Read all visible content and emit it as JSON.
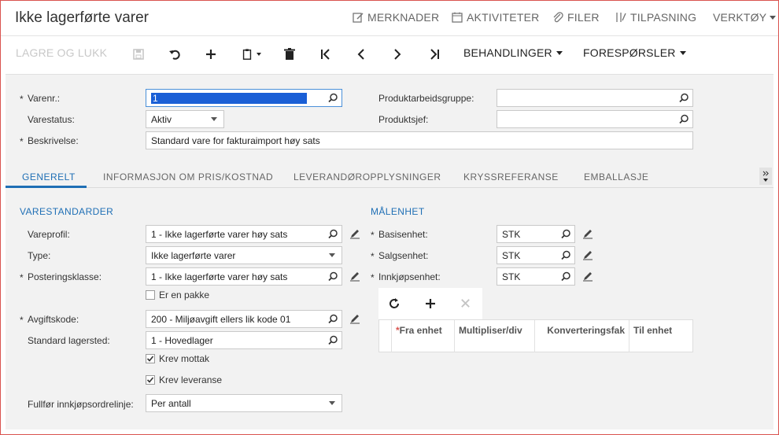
{
  "header": {
    "title": "Ikke lagerførte varer",
    "links": {
      "notes": "MERKNADER",
      "activities": "AKTIVITETER",
      "files": "FILER",
      "customize": "TILPASNING",
      "tools": "VERKTØY"
    }
  },
  "toolbar": {
    "save_close": "LAGRE OG LUKK",
    "actions": "BEHANDLINGER",
    "inquiries": "FORESPØRSLER"
  },
  "form": {
    "item_no": {
      "label": "Varenr.:",
      "value": "1"
    },
    "item_status": {
      "label": "Varestatus:",
      "value": "Aktiv"
    },
    "description": {
      "label": "Beskrivelse:",
      "value": "Standard vare for fakturaimport høy sats"
    },
    "product_workgroup": {
      "label": "Produktarbeidsgruppe:",
      "value": ""
    },
    "product_manager": {
      "label": "Produktsjef:",
      "value": ""
    }
  },
  "tabs": [
    {
      "label": "GENERELT"
    },
    {
      "label": "INFORMASJON OM PRIS/KOSTNAD"
    },
    {
      "label": "LEVERANDØROPPLYSNINGER"
    },
    {
      "label": "KRYSSREFERANSE"
    },
    {
      "label": "EMBALLASJE"
    }
  ],
  "general": {
    "section_defaults": "VARESTANDARDER",
    "item_profile": {
      "label": "Vareprofil:",
      "value": "1 - Ikke lagerførte varer høy sats"
    },
    "type": {
      "label": "Type:",
      "value": "Ikke lagerførte varer"
    },
    "posting_class": {
      "label": "Posteringsklasse:",
      "value": "1 - Ikke lagerførte varer høy sats"
    },
    "is_kit": {
      "label": "Er en pakke",
      "checked": false
    },
    "tax_code": {
      "label": "Avgiftskode:",
      "value": "200 - Miljøavgift ellers lik kode 01"
    },
    "default_warehouse": {
      "label": "Standard lagersted:",
      "value": "1 - Hovedlager"
    },
    "require_receipt": {
      "label": "Krev mottak",
      "checked": true
    },
    "require_shipment": {
      "label": "Krev leveranse",
      "checked": true
    },
    "complete_po_line": {
      "label": "Fullfør innkjøpsordrelinje:",
      "value": "Per antall"
    }
  },
  "uom": {
    "section": "MÅLENHET",
    "base_unit": {
      "label": "Basisenhet:",
      "value": "STK"
    },
    "sales_unit": {
      "label": "Salgsenhet:",
      "value": "STK"
    },
    "purchase_unit": {
      "label": "Innkjøpsenhet:",
      "value": "STK"
    },
    "grid_columns": [
      {
        "label": "Fra enhet"
      },
      {
        "label": "Multipliser/div"
      },
      {
        "label": "Konverteringsfak"
      },
      {
        "label": "Til enhet"
      }
    ]
  },
  "colors": {
    "accent": "#1f6fb5",
    "selection": "#1a5fd6",
    "panel": "#f2f2f2"
  }
}
